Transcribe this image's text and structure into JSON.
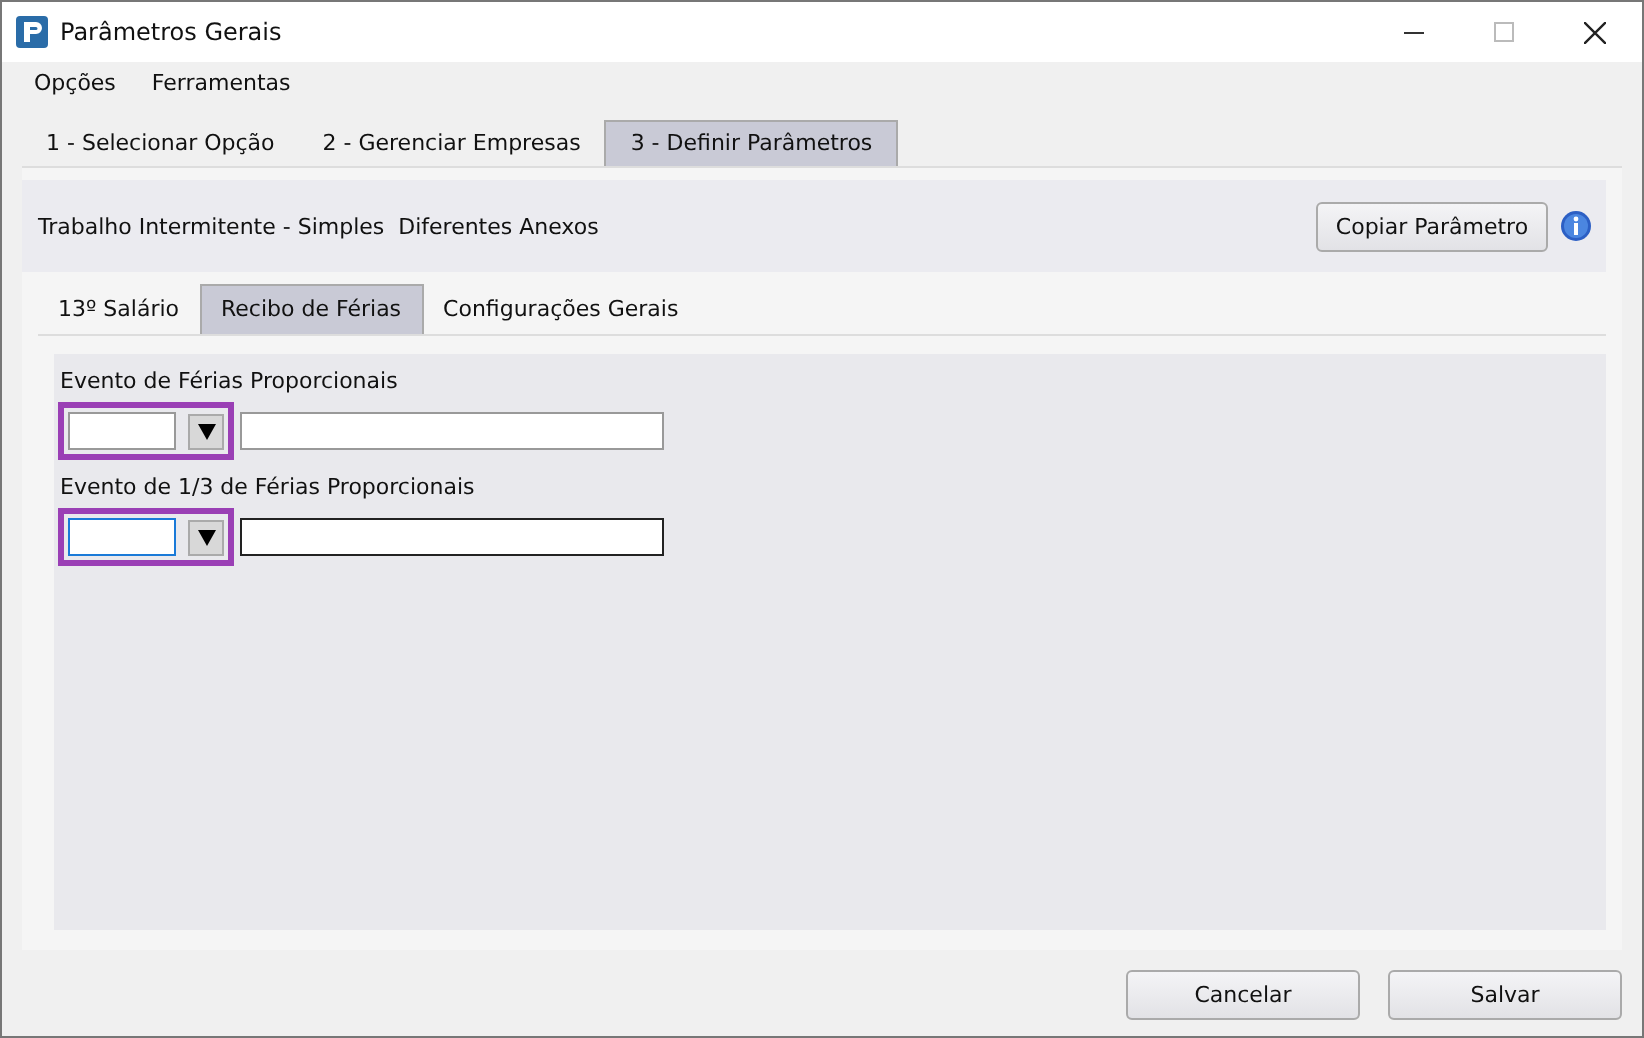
{
  "window": {
    "title": "Parâmetros Gerais"
  },
  "menu": [
    "Opções",
    "Ferramentas"
  ],
  "tabs": [
    {
      "label": "1 - Selecionar Opção",
      "selected": false
    },
    {
      "label": "2 - Gerenciar Empresas",
      "selected": false
    },
    {
      "label": "3 - Definir Parâmetros",
      "selected": true
    }
  ],
  "header": {
    "text": "Trabalho Intermitente - Simples  Diferentes Anexos",
    "button": "Copiar Parâmetro"
  },
  "subtabs": [
    {
      "label": "13º Salário",
      "selected": false
    },
    {
      "label": "Recibo de Férias",
      "selected": true
    },
    {
      "label": "Configurações Gerais",
      "selected": false
    }
  ],
  "fields": [
    {
      "label": "Evento de Férias Proporcionais",
      "focused": false,
      "highlighted": true
    },
    {
      "label": "Evento de 1/3 de Férias Proporcionais",
      "focused": true,
      "highlighted": true
    }
  ],
  "buttons": [
    "Cancelar",
    "Salvar"
  ]
}
